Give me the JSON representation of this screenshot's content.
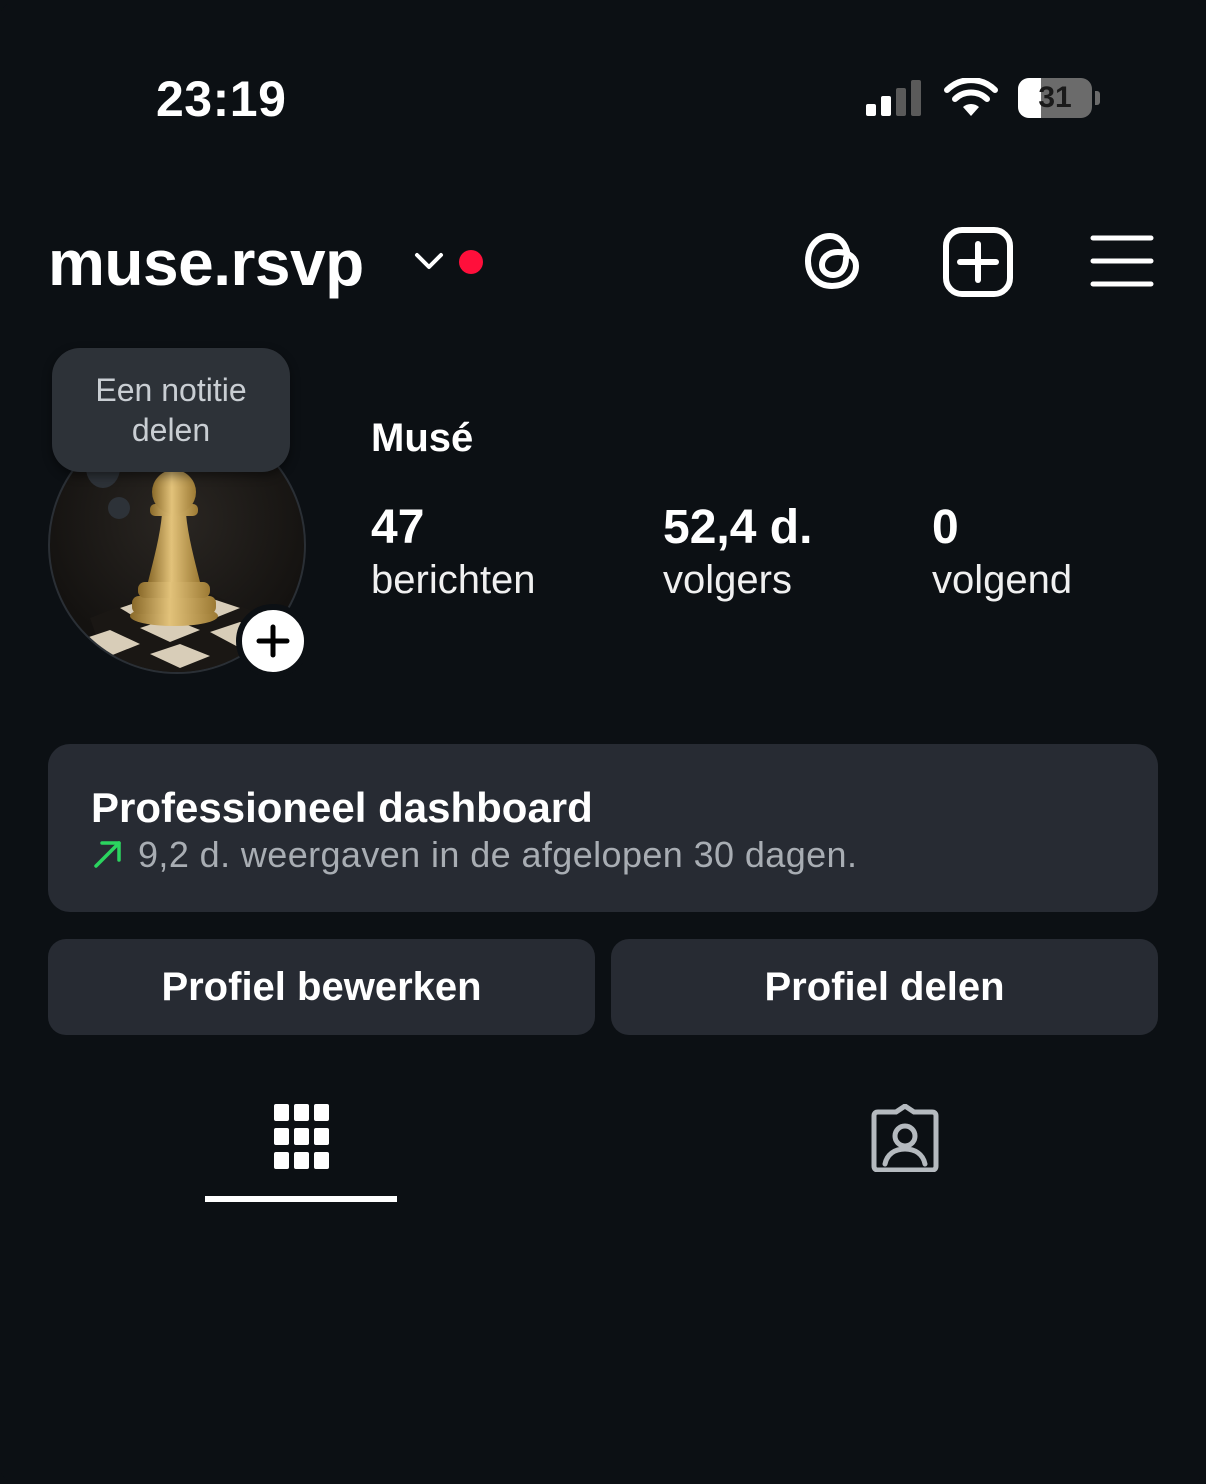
{
  "status_bar": {
    "time": "23:19",
    "battery_percent": "31",
    "battery_level": 0.31
  },
  "header": {
    "username": "muse.rsvp",
    "icons": [
      "chevron-down-icon",
      "notification-dot",
      "threads-icon",
      "create-icon",
      "menu-icon"
    ]
  },
  "profile": {
    "note_text": "Een notitie delen",
    "display_name": "Musé",
    "stats": [
      {
        "count": "47",
        "label": "berichten"
      },
      {
        "count": "52,4 d.",
        "label": "volgers"
      },
      {
        "count": "0",
        "label": "volgend"
      }
    ]
  },
  "dashboard": {
    "title": "Professioneel dashboard",
    "subtitle": "9,2 d. weergaven in de afgelopen 30 dagen."
  },
  "actions": {
    "edit_label": "Profiel bewerken",
    "share_label": "Profiel delen"
  },
  "tabs": [
    {
      "icon": "grid-icon",
      "active": true
    },
    {
      "icon": "tagged-icon",
      "active": false
    }
  ],
  "colors": {
    "background": "#0c1014",
    "card": "#272b33",
    "accent_red": "#ff0f3b",
    "trend_green": "#2bd45f"
  }
}
